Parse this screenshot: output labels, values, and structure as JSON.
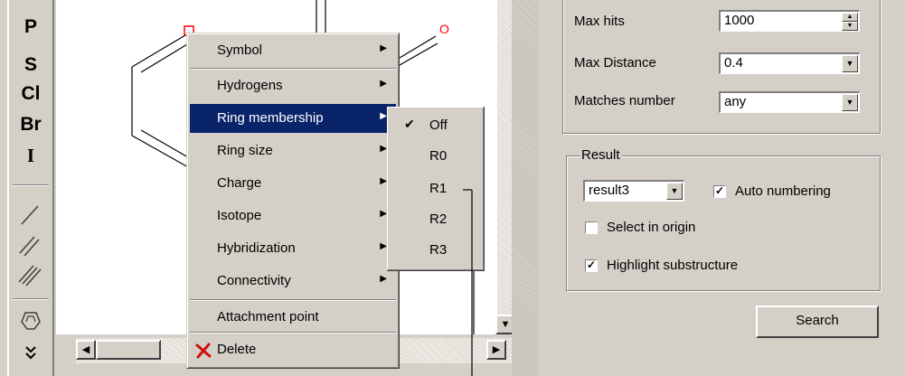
{
  "toolbar": {
    "elements": [
      "P",
      "S",
      "Cl",
      "Br",
      "I"
    ],
    "tools": [
      "single-bond-tool",
      "double-bond-tool",
      "triple-bond-tool",
      "ring-template-tool",
      "more-tools"
    ]
  },
  "canvas": {
    "atom_label": "O"
  },
  "context_menu": {
    "items": [
      {
        "label": "Symbol",
        "has_submenu": true
      },
      {
        "label": "Hydrogens",
        "has_submenu": true
      },
      {
        "label": "Ring membership",
        "has_submenu": true,
        "highlighted": true
      },
      {
        "label": "Ring size",
        "has_submenu": true
      },
      {
        "label": "Charge",
        "has_submenu": true
      },
      {
        "label": "Isotope",
        "has_submenu": true
      },
      {
        "label": "Hybridization",
        "has_submenu": true
      },
      {
        "label": "Connectivity",
        "has_submenu": true
      },
      {
        "label": "Attachment point",
        "has_submenu": false
      },
      {
        "label": "Delete",
        "has_submenu": false,
        "icon": "red-x-icon"
      }
    ]
  },
  "ring_membership_submenu": {
    "items": [
      {
        "label": "Off",
        "checked": true
      },
      {
        "label": "R0",
        "checked": false
      },
      {
        "label": "R1",
        "checked": false
      },
      {
        "label": "R2",
        "checked": false
      },
      {
        "label": "R3",
        "checked": false
      }
    ]
  },
  "search_options": {
    "max_hits_label": "Max hits",
    "max_hits_value": "1000",
    "max_distance_label": "Max Distance",
    "max_distance_value": "0.4",
    "matches_number_label": "Matches number",
    "matches_number_value": "any"
  },
  "result": {
    "group_label": "Result",
    "result_value": "result3",
    "auto_numbering_label": "Auto numbering",
    "auto_numbering_checked": true,
    "select_in_origin_label": "Select in origin",
    "select_in_origin_checked": false,
    "highlight_label": "Highlight substructure",
    "highlight_checked": true
  },
  "search_button_label": "Search",
  "colors": {
    "menu_highlight": "#0a246a",
    "atom_red": "#ff0000",
    "window_bg": "#d4d0c8"
  }
}
